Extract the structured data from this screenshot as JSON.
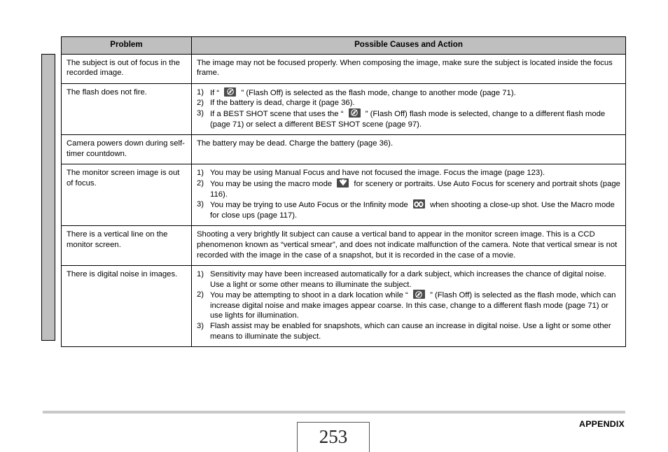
{
  "document": {
    "section_label": "APPENDIX",
    "page_number": "253"
  },
  "table": {
    "headers": {
      "problem": "Problem",
      "cause": "Possible Causes and Action"
    },
    "rows": [
      {
        "problem": "The subject is out of focus in the recorded image.",
        "cause_type": "plain",
        "cause_text": "The image may not be focused properly. When composing the image, make sure the subject is located inside the focus frame."
      },
      {
        "problem": "The flash does not fire.",
        "cause_type": "list",
        "steps": [
          {
            "num": "1)",
            "parts": [
              {
                "t": "text",
                "v": "If “ "
              },
              {
                "t": "icon",
                "v": "flash-off-icon"
              },
              {
                "t": "text",
                "v": " ” (Flash Off) is selected as the flash mode, change to another mode (page 71)."
              }
            ]
          },
          {
            "num": "2)",
            "parts": [
              {
                "t": "text",
                "v": "If the battery is dead, charge it (page 36)."
              }
            ]
          },
          {
            "num": "3)",
            "parts": [
              {
                "t": "text",
                "v": "If a BEST SHOT scene that uses the “ "
              },
              {
                "t": "icon",
                "v": "flash-off-icon"
              },
              {
                "t": "text",
                "v": " ” (Flash Off) flash mode is selected, change to a different flash mode (page 71) or select a different BEST SHOT scene (page 97)."
              }
            ]
          }
        ]
      },
      {
        "problem": "Camera powers down during self-timer countdown.",
        "cause_type": "plain",
        "cause_text": "The battery may be dead. Charge the battery (page 36)."
      },
      {
        "problem": "The monitor screen image is out of focus.",
        "cause_type": "list",
        "steps": [
          {
            "num": "1)",
            "parts": [
              {
                "t": "text",
                "v": "You may be using Manual Focus and have not focused the image. Focus the image (page 123)."
              }
            ]
          },
          {
            "num": "2)",
            "parts": [
              {
                "t": "text",
                "v": "You may be using the macro mode "
              },
              {
                "t": "icon",
                "v": "macro-flower-icon"
              },
              {
                "t": "text",
                "v": " for scenery or portraits. Use Auto Focus for scenery and portrait shots (page 116)."
              }
            ]
          },
          {
            "num": "3)",
            "parts": [
              {
                "t": "text",
                "v": "You may be trying to use Auto Focus or the Infinity mode "
              },
              {
                "t": "icon",
                "v": "infinity-icon"
              },
              {
                "t": "text",
                "v": " when shooting a close-up shot. Use the Macro mode for close ups (page 117)."
              }
            ]
          }
        ]
      },
      {
        "problem": "There is a vertical line on the monitor screen.",
        "cause_type": "plain",
        "cause_text": "Shooting a very brightly lit subject can cause a vertical band to appear in the monitor screen image. This is a CCD phenomenon known as “vertical smear”, and does not indicate malfunction of the camera. Note that vertical smear is not recorded with the image in the case of a snapshot, but it is recorded in the case of a movie."
      },
      {
        "problem": "There is digital noise in images.",
        "cause_type": "list",
        "steps": [
          {
            "num": "1)",
            "parts": [
              {
                "t": "text",
                "v": "Sensitivity may have been increased automatically for a dark subject, which increases the chance of digital noise. Use a light or some other means to illuminate the subject."
              }
            ]
          },
          {
            "num": "2)",
            "parts": [
              {
                "t": "text",
                "v": "You may be attempting to shoot in a dark location while “ "
              },
              {
                "t": "icon",
                "v": "flash-off-icon"
              },
              {
                "t": "text",
                "v": " ” (Flash Off) is selected as the flash mode, which can increase digital noise and make images appear coarse. In this case, change to a different flash mode (page 71) or use lights for illumination."
              }
            ]
          },
          {
            "num": "3)",
            "parts": [
              {
                "t": "text",
                "v": "Flash assist may be enabled for snapshots, which can cause an increase in digital noise. Use a light or some other means to illuminate the subject."
              }
            ]
          }
        ]
      }
    ]
  },
  "colors": {
    "header_fill": "#bfbfbf",
    "tab_fill": "#bfbfbf",
    "rule_fill": "#c8c8c8",
    "icon_fill": "#4a4a4a"
  }
}
